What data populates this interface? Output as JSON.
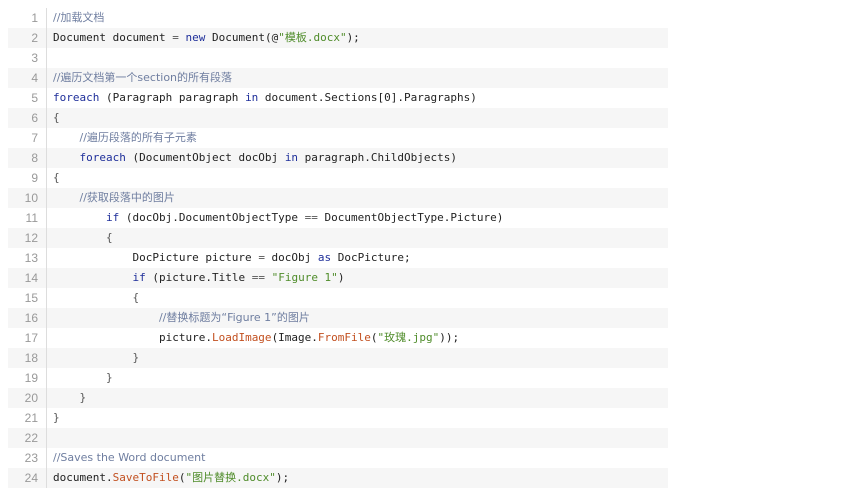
{
  "colors": {
    "comment": "#6f7ea0",
    "keyword": "#1f2f9a",
    "method": "#c25020",
    "string": "#4f8c2a",
    "gutter": "#999999",
    "alt_row": "#f6f6f6"
  },
  "lines": [
    {
      "num": "1",
      "tokens": [
        {
          "t": "comment",
          "v": "//加载文档"
        }
      ]
    },
    {
      "num": "2",
      "tokens": [
        {
          "t": "plain",
          "v": "Document document "
        },
        {
          "t": "op",
          "v": "="
        },
        {
          "t": "plain",
          "v": " "
        },
        {
          "t": "keyword",
          "v": "new"
        },
        {
          "t": "plain",
          "v": " Document(@"
        },
        {
          "t": "string",
          "v": "\"模板.docx\""
        },
        {
          "t": "plain",
          "v": ");"
        }
      ]
    },
    {
      "num": "3",
      "tokens": []
    },
    {
      "num": "4",
      "tokens": [
        {
          "t": "comment",
          "v": "//遍历文档第一个section的所有段落"
        }
      ]
    },
    {
      "num": "5",
      "tokens": [
        {
          "t": "keyword",
          "v": "foreach"
        },
        {
          "t": "plain",
          "v": " (Paragraph paragraph "
        },
        {
          "t": "keyword",
          "v": "in"
        },
        {
          "t": "plain",
          "v": " document.Sections[0].Paragraphs)"
        }
      ]
    },
    {
      "num": "6",
      "tokens": [
        {
          "t": "op",
          "v": "{"
        }
      ]
    },
    {
      "num": "7",
      "tokens": [
        {
          "t": "plain",
          "v": "    "
        },
        {
          "t": "comment",
          "v": "//遍历段落的所有子元素"
        }
      ]
    },
    {
      "num": "8",
      "tokens": [
        {
          "t": "plain",
          "v": "    "
        },
        {
          "t": "keyword",
          "v": "foreach"
        },
        {
          "t": "plain",
          "v": " (DocumentObject docObj "
        },
        {
          "t": "keyword",
          "v": "in"
        },
        {
          "t": "plain",
          "v": " paragraph.ChildObjects)"
        }
      ]
    },
    {
      "num": "9",
      "tokens": [
        {
          "t": "op",
          "v": "{"
        }
      ]
    },
    {
      "num": "10",
      "tokens": [
        {
          "t": "plain",
          "v": "    "
        },
        {
          "t": "comment",
          "v": "//获取段落中的图片"
        }
      ]
    },
    {
      "num": "11",
      "tokens": [
        {
          "t": "plain",
          "v": "        "
        },
        {
          "t": "keyword",
          "v": "if"
        },
        {
          "t": "plain",
          "v": " (docObj.DocumentObjectType "
        },
        {
          "t": "op",
          "v": "=="
        },
        {
          "t": "plain",
          "v": " DocumentObjectType.Picture)"
        }
      ]
    },
    {
      "num": "12",
      "tokens": [
        {
          "t": "plain",
          "v": "        "
        },
        {
          "t": "op",
          "v": "{"
        }
      ]
    },
    {
      "num": "13",
      "tokens": [
        {
          "t": "plain",
          "v": "            DocPicture picture "
        },
        {
          "t": "op",
          "v": "="
        },
        {
          "t": "plain",
          "v": " docObj "
        },
        {
          "t": "keyword",
          "v": "as"
        },
        {
          "t": "plain",
          "v": " DocPicture;"
        }
      ]
    },
    {
      "num": "14",
      "tokens": [
        {
          "t": "plain",
          "v": "            "
        },
        {
          "t": "keyword",
          "v": "if"
        },
        {
          "t": "plain",
          "v": " (picture.Title "
        },
        {
          "t": "op",
          "v": "=="
        },
        {
          "t": "plain",
          "v": " "
        },
        {
          "t": "string",
          "v": "\"Figure 1\""
        },
        {
          "t": "plain",
          "v": ")"
        }
      ]
    },
    {
      "num": "15",
      "tokens": [
        {
          "t": "plain",
          "v": "            "
        },
        {
          "t": "op",
          "v": "{"
        }
      ]
    },
    {
      "num": "16",
      "tokens": [
        {
          "t": "plain",
          "v": "                "
        },
        {
          "t": "comment",
          "v": "//替换标题为“Figure 1”的图片"
        }
      ]
    },
    {
      "num": "17",
      "tokens": [
        {
          "t": "plain",
          "v": "                picture."
        },
        {
          "t": "method",
          "v": "LoadImage"
        },
        {
          "t": "plain",
          "v": "(Image."
        },
        {
          "t": "method",
          "v": "FromFile"
        },
        {
          "t": "plain",
          "v": "("
        },
        {
          "t": "string",
          "v": "\"玫瑰.jpg\""
        },
        {
          "t": "plain",
          "v": "));"
        }
      ]
    },
    {
      "num": "18",
      "tokens": [
        {
          "t": "plain",
          "v": "            "
        },
        {
          "t": "op",
          "v": "}"
        }
      ]
    },
    {
      "num": "19",
      "tokens": [
        {
          "t": "plain",
          "v": "        "
        },
        {
          "t": "op",
          "v": "}"
        }
      ]
    },
    {
      "num": "20",
      "tokens": [
        {
          "t": "plain",
          "v": "    "
        },
        {
          "t": "op",
          "v": "}"
        }
      ]
    },
    {
      "num": "21",
      "tokens": [
        {
          "t": "op",
          "v": "}"
        }
      ]
    },
    {
      "num": "22",
      "tokens": []
    },
    {
      "num": "23",
      "tokens": [
        {
          "t": "comment",
          "v": "//Saves the Word document"
        }
      ]
    },
    {
      "num": "24",
      "tokens": [
        {
          "t": "plain",
          "v": "document."
        },
        {
          "t": "method",
          "v": "SaveToFile"
        },
        {
          "t": "plain",
          "v": "("
        },
        {
          "t": "string",
          "v": "\"图片替换.docx\""
        },
        {
          "t": "plain",
          "v": ");"
        }
      ]
    }
  ]
}
